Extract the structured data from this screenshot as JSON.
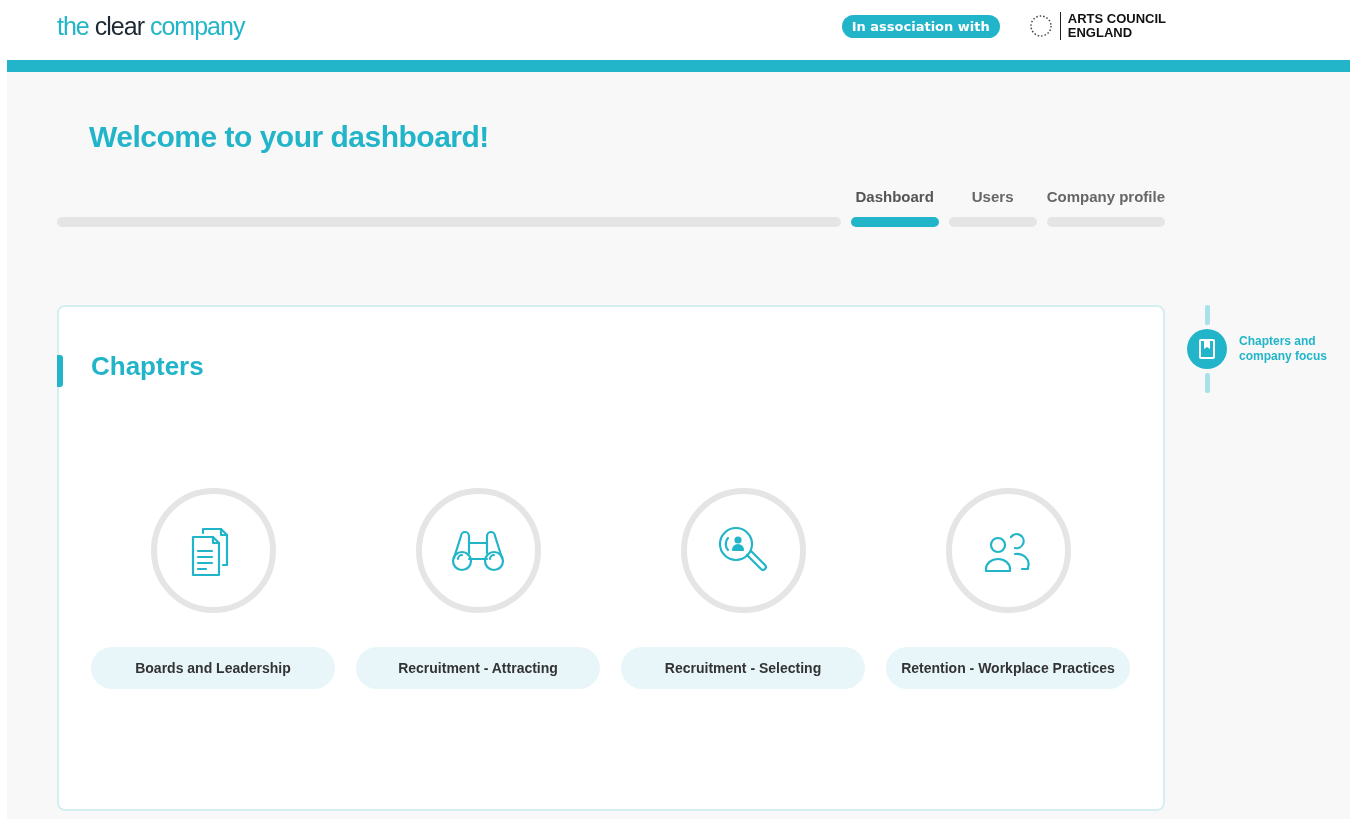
{
  "header": {
    "logo_words": [
      "the",
      "clear",
      "company"
    ],
    "association_badge": "In association with",
    "partner_logo": {
      "line_1": "ARTS COUNCIL",
      "line_2": "ENGLAND"
    }
  },
  "page_title": "Welcome to your dashboard!",
  "tabs": [
    {
      "label": "Dashboard",
      "selected": true
    },
    {
      "label": "Users",
      "selected": false
    },
    {
      "label": "Company profile",
      "selected": false
    }
  ],
  "chapters": {
    "title": "Chapters",
    "items": [
      {
        "label": "Boards and Leadership",
        "kind": "documents"
      },
      {
        "label": "Recruitment - Attracting",
        "kind": "binoculars"
      },
      {
        "label": "Recruitment - Selecting",
        "kind": "search"
      },
      {
        "label": "Retention - Workplace Practices",
        "kind": "people"
      }
    ]
  },
  "side_steps": [
    {
      "label": "Chapters and company focus",
      "selected": true
    }
  ]
}
